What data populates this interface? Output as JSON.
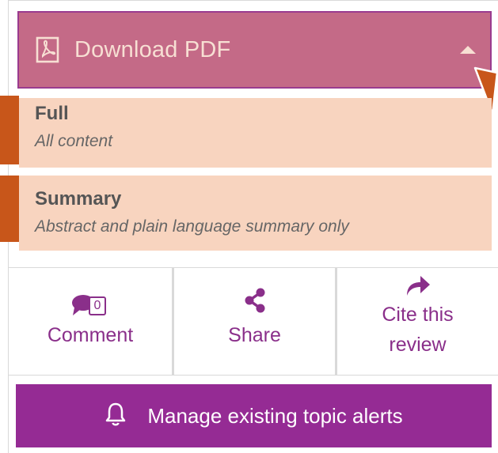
{
  "download": {
    "label": "Download PDF",
    "icon": "pdf-file-icon",
    "state_icon": "caret-up-icon"
  },
  "options": [
    {
      "title": "Full",
      "description": "All content"
    },
    {
      "title": "Summary",
      "description": "Abstract and plain language summary only"
    }
  ],
  "actions": {
    "comment": {
      "label": "Comment",
      "count": "0",
      "icon": "comment-bubble-icon"
    },
    "share": {
      "label": "Share",
      "icon": "share-icon"
    },
    "cite": {
      "line1": "Cite this",
      "line2": "review",
      "icon": "reply-arrow-icon"
    }
  },
  "alerts": {
    "label": "Manage existing topic alerts",
    "icon": "bell-icon"
  },
  "colors": {
    "download_bg": "#c46a87",
    "option_bg": "#f8d4bf",
    "marker": "#c8561a",
    "accent": "#952b94"
  }
}
